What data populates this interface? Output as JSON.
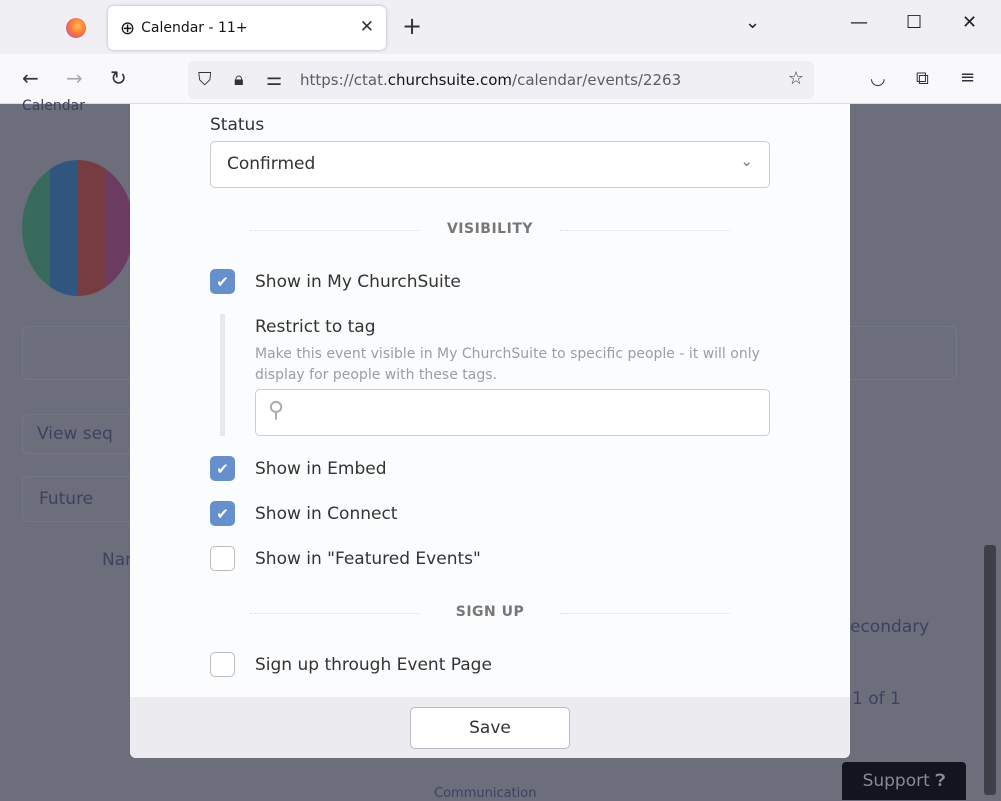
{
  "browser": {
    "tab_title": "Calendar - 11+",
    "url_prefix": "https://ctat.",
    "url_domain": "churchsuite.com",
    "url_path": "/calendar/events/2263"
  },
  "background": {
    "nav_label": "Calendar",
    "view_button": "View seq",
    "filter": "Future",
    "column": "Nar",
    "cell": "econdary",
    "pagination": "1 of 1",
    "footer": "Communication",
    "support": "Support"
  },
  "modal": {
    "status_label": "Status",
    "status_value": "Confirmed",
    "visibility_heading": "VISIBILITY",
    "show_my_churchsuite": {
      "label": "Show in My ChurchSuite",
      "checked": true
    },
    "restrict_label": "Restrict to tag",
    "restrict_help": "Make this event visible in My ChurchSuite to specific people - it will only display for people with these tags.",
    "tag_search_value": "",
    "show_embed": {
      "label": "Show in Embed",
      "checked": true
    },
    "show_connect": {
      "label": "Show in Connect",
      "checked": true
    },
    "show_featured": {
      "label": "Show in \"Featured Events\"",
      "checked": false
    },
    "signup_heading": "SIGN UP",
    "signup_event_page": {
      "label": "Sign up through Event Page",
      "checked": false
    },
    "save_label": "Save"
  },
  "colors": {
    "accent": "#6690cb",
    "overlay": "#6c6f7b"
  }
}
